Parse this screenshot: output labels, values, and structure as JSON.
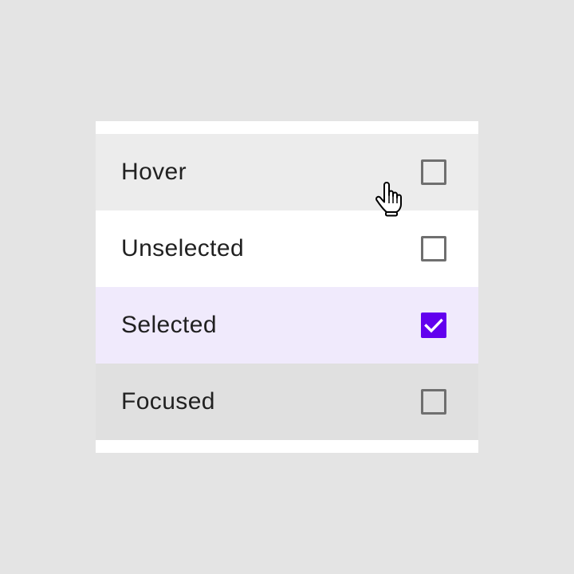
{
  "list": {
    "items": [
      {
        "label": "Hover",
        "state": "hover",
        "checked": false
      },
      {
        "label": "Unselected",
        "state": "unselected",
        "checked": false
      },
      {
        "label": "Selected",
        "state": "selected",
        "checked": true
      },
      {
        "label": "Focused",
        "state": "focused",
        "checked": false
      }
    ]
  },
  "colors": {
    "page_background": "#e4e4e4",
    "card_background": "#ffffff",
    "hover_background": "#ececec",
    "selected_background": "#f0eafc",
    "focused_background": "#e0e0e0",
    "checkbox_border": "#6f6f6f",
    "checkbox_checked_fill": "#6200ee",
    "text": "#212121"
  },
  "icons": {
    "cursor": "hand-pointer-icon",
    "check": "check-icon"
  }
}
